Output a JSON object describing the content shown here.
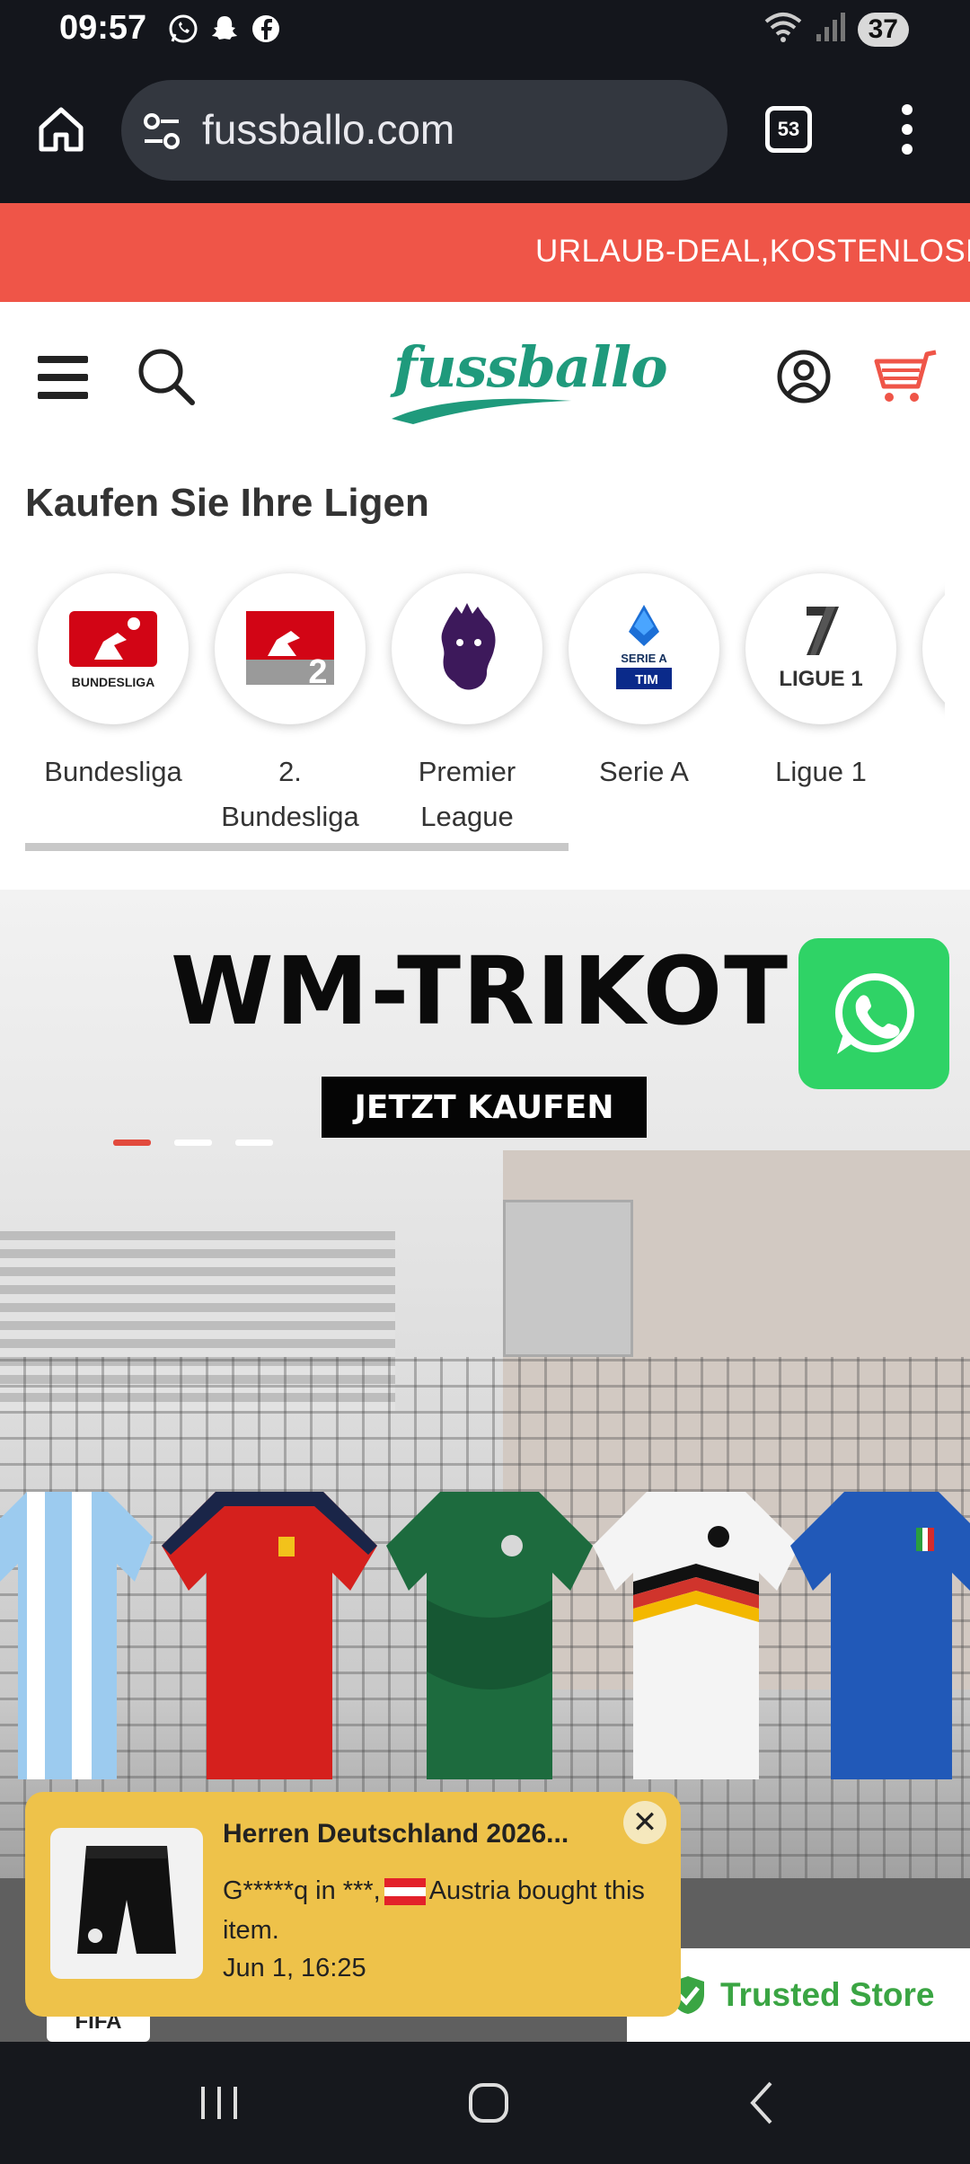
{
  "status_bar": {
    "time": "09:57",
    "battery": "37",
    "icons": [
      "whatsapp-icon",
      "snapchat-icon",
      "facebook-icon",
      "wifi-icon",
      "signal-icon"
    ]
  },
  "browser": {
    "url": "fussballo.com",
    "tab_count": "53"
  },
  "announcement": {
    "text": "URLAUB-DEAL,KOSTENLOSE"
  },
  "header": {
    "logo_text": "fussballo"
  },
  "leagues": {
    "title": "Kaufen Sie Ihre Ligen",
    "items": [
      {
        "label": "Bundesliga",
        "logo_caption": "BUNDESLIGA"
      },
      {
        "label": "2.\nBundesliga",
        "logo_caption": "2"
      },
      {
        "label": "Premier\nLeague",
        "logo_caption": ""
      },
      {
        "label": "Serie A",
        "logo_caption": "SERIE A"
      },
      {
        "label": "Ligue 1",
        "logo_caption": "LIGUE 1"
      }
    ]
  },
  "hero": {
    "title": "WM-TRIKOT",
    "cta": "JETZT KAUFEN"
  },
  "popup": {
    "title": "Herren Deutschland 2026...",
    "buyer_text_before_flag": "G*****q in ***,",
    "buyer_text_after_flag": "Austria bought this item.",
    "date": "Jun 1, 16:25",
    "close": "✕"
  },
  "badges": {
    "trusted_store": "Trusted Store",
    "fifa": "FIFA"
  },
  "colors": {
    "announce_bg": "#ef5548",
    "logo_green": "#1f9a7c",
    "popup_bg": "#eec24a",
    "whatsapp_green": "#2fd366",
    "trusted_green": "#3aa543"
  },
  "carousel": {
    "slides": 3,
    "active": 1
  }
}
